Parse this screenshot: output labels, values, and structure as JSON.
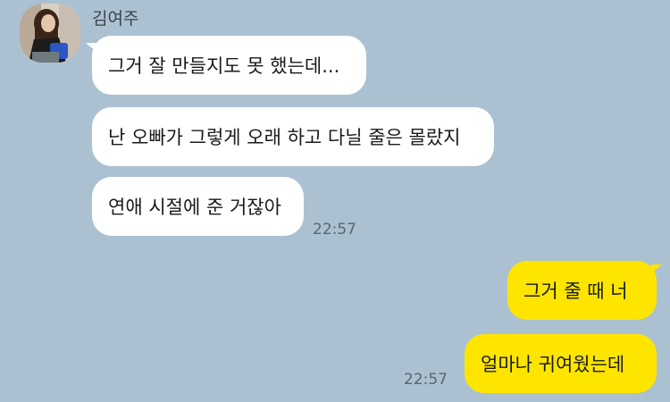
{
  "sender": {
    "name": "김여주"
  },
  "messages": {
    "incoming": [
      {
        "text": "그거 잘 만들지도 못 했는데..."
      },
      {
        "text": "난 오빠가 그렇게 오래 하고 다닐 줄은 몰랐지"
      },
      {
        "text": "연애 시절에 준 거잖아",
        "time": "22:57"
      }
    ],
    "outgoing": [
      {
        "text": "그거 줄 때 너"
      },
      {
        "text": "얼마나 귀여웠는데",
        "time": "22:57"
      }
    ]
  },
  "colors": {
    "background": "#abc1d1",
    "incoming_bubble": "#ffffff",
    "outgoing_bubble": "#fee500"
  },
  "icons": {
    "avatar": "profile-photo"
  }
}
